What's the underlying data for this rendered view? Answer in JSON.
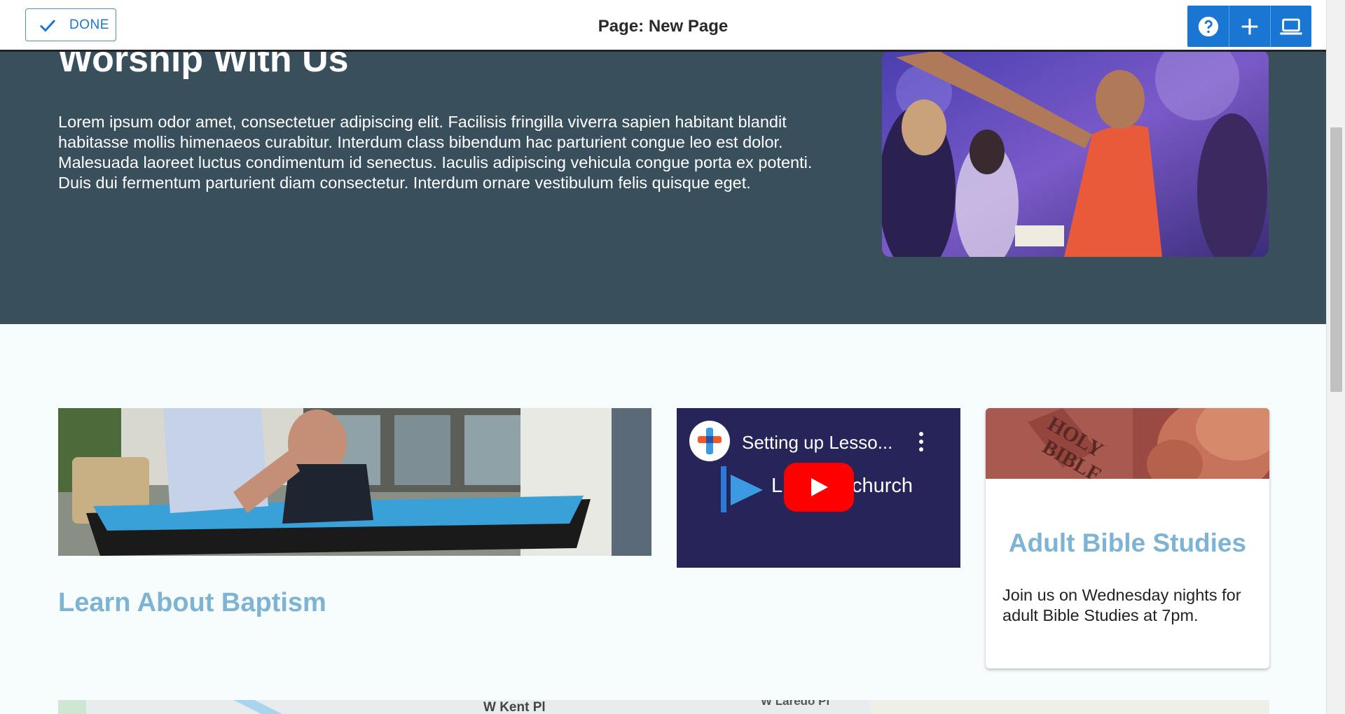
{
  "editor": {
    "done_label": "DONE",
    "page_title": "Page: New Page",
    "accent_color": "#1976d2",
    "tools": [
      "help-icon",
      "add-icon",
      "laptop-icon"
    ]
  },
  "hero": {
    "title": "Worship With Us",
    "text": "Lorem ipsum odor amet, consectetuer adipiscing elit. Facilisis fringilla viverra sapien habitant blandit habitasse mollis himenaeos curabitur. Interdum class bibendum hac parturient congue leo est dolor. Malesuada laoreet luctus condimentum id senectus. Iaculis adipiscing vehicula congue porta ex potenti. Duis dui fermentum parturient diam consectetur. Interdum ornare vestibulum felis quisque eget.",
    "background_color": "#394f5c"
  },
  "baptism": {
    "title": "Learn About Baptism"
  },
  "video": {
    "title": "Setting up Lesso...",
    "brand_start": "L",
    "brand_end": "church"
  },
  "bible_card": {
    "title": "Adult Bible Studies",
    "text": "Join us on Wednesday nights for adult Bible Studies at 7pm."
  },
  "map": {
    "street1": "W Kent Pl",
    "street2": "W Laredo Pl"
  }
}
